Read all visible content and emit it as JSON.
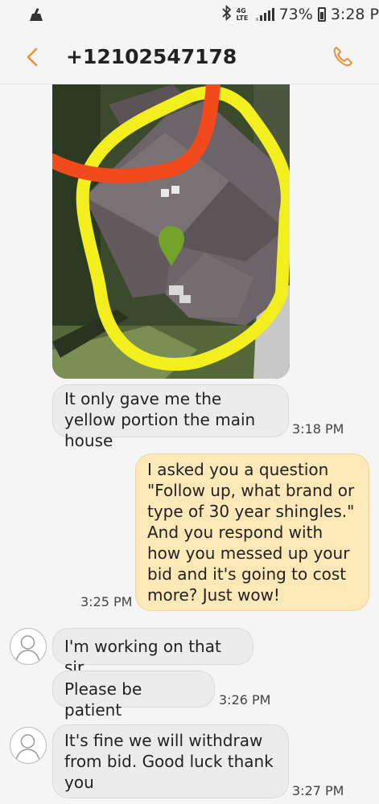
{
  "status": {
    "network": "4G LTE",
    "battery": "73%",
    "time": "3:28 P"
  },
  "header": {
    "contact": "+12102547178"
  },
  "messages": [
    {
      "text": "It only gave me the yellow portion the main house",
      "time": "3:18 PM"
    },
    {
      "text": "I asked you a question \"Follow up, what brand or type of 30 year shingles.\" And you respond with how you messed up your bid and it's going to cost more? Just wow!",
      "time": "3:25 PM"
    },
    {
      "text": "I'm working on that sir",
      "time": ""
    },
    {
      "text": "Please be patient",
      "time": "3:26 PM"
    },
    {
      "text": "It's fine we will withdraw from bid.  Good luck thank you",
      "time": "3:27 PM"
    }
  ],
  "colors": {
    "accent": "#e8923a",
    "outgoing_bubble": "#fde8b8",
    "incoming_bubble": "#ececec",
    "highlight_yellow": "#f3ee1d",
    "highlight_red": "#f24a1c",
    "map_pin": "#74a32c"
  }
}
